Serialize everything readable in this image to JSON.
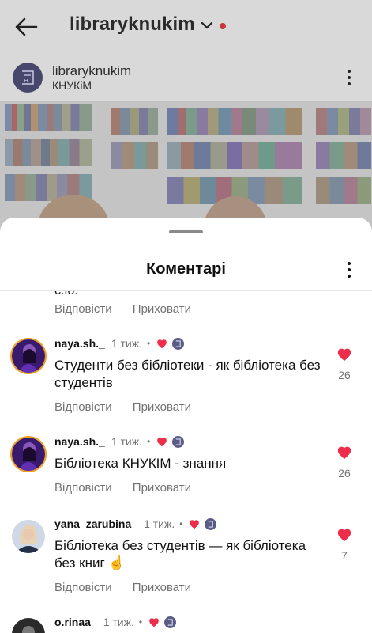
{
  "header": {
    "title": "libraryknukim",
    "post_user": "libraryknukim",
    "post_subtitle": "КНУКіМ"
  },
  "sheet": {
    "title": "Коментарі",
    "cut_text": "є.іб."
  },
  "actions": {
    "reply": "Відповісти",
    "hide": "Приховати"
  },
  "comments": [
    {
      "user": "naya.sh._",
      "time": "1 тиж.",
      "bullet": "•",
      "text": "Студенти без бібліотеки - як бібліотека без студентів",
      "likes": "26"
    },
    {
      "user": "naya.sh._",
      "time": "1 тиж.",
      "bullet": "•",
      "text": "Бібліотека КНУКІМ - знання",
      "likes": "26"
    },
    {
      "user": "yana_zarubina_",
      "time": "1 тиж.",
      "bullet": "•",
      "text": "Бібліотека без студентів — як бібліотека без книг ☝️",
      "likes": "7"
    },
    {
      "user": "o.rinaa_",
      "time": "1 тиж.",
      "bullet": "•"
    }
  ],
  "colors": {
    "heart": "#ed2d49",
    "muted": "#737373",
    "brand_avatar": "#46476b"
  }
}
